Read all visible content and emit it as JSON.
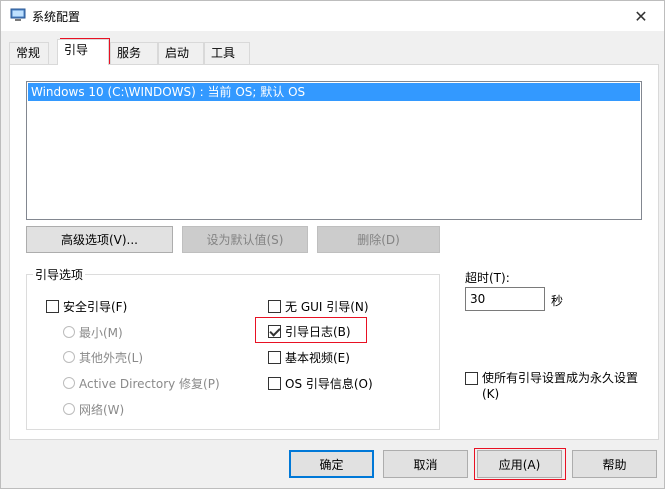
{
  "window": {
    "title": "系统配置",
    "close_glyph": "✕"
  },
  "tabs": [
    {
      "label": "常规"
    },
    {
      "label": "引导"
    },
    {
      "label": "服务"
    },
    {
      "label": "启动"
    },
    {
      "label": "工具"
    }
  ],
  "active_tab": "引导",
  "os_list": {
    "items": [
      "Windows 10 (C:\\WINDOWS) : 当前 OS; 默认 OS"
    ]
  },
  "list_buttons": {
    "advanced": "高级选项(V)...",
    "set_default": "设为默认值(S)",
    "delete": "删除(D)"
  },
  "boot_options": {
    "legend": "引导选项",
    "safe_boot": {
      "label": "安全引导(F)",
      "checked": false
    },
    "minimal": "最小(M)",
    "alternate_shell": "其他外壳(L)",
    "ad_repair": "Active Directory 修复(P)",
    "network": "网络(W)",
    "no_gui_boot": {
      "label": "无 GUI 引导(N)",
      "checked": false
    },
    "boot_log": {
      "label": "引导日志(B)",
      "checked": true
    },
    "base_video": {
      "label": "基本视频(E)",
      "checked": false
    },
    "os_boot_info": {
      "label": "OS 引导信息(O)",
      "checked": false
    }
  },
  "timeout": {
    "label": "超时(T):",
    "value": "30",
    "unit": "秒"
  },
  "make_permanent": {
    "label": "使所有引导设置成为永久设置(K)",
    "checked": false
  },
  "footer_buttons": {
    "ok": "确定",
    "cancel": "取消",
    "apply": "应用(A)",
    "help": "帮助"
  },
  "colors": {
    "selection": "#3399ff",
    "annotation": "#e81123",
    "default_button_border": "#0078d7"
  }
}
